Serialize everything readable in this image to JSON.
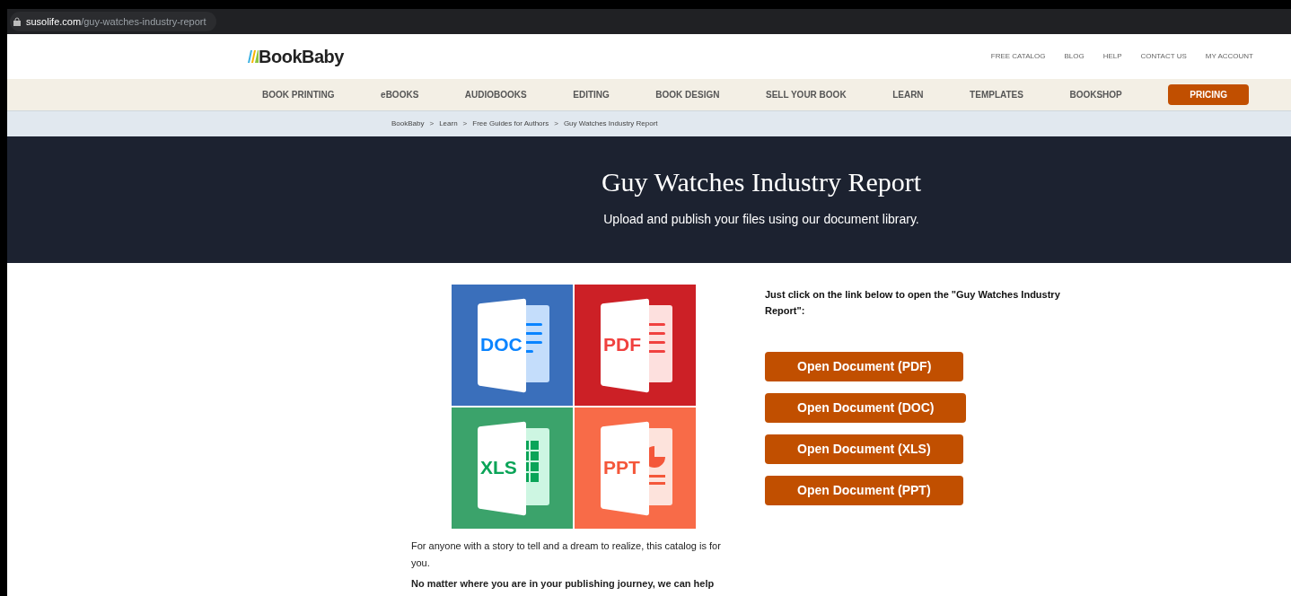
{
  "address_bar": {
    "domain": "susolife.com",
    "path": "/guy-watches-industry-report"
  },
  "logo": "BookBaby",
  "top_links": [
    "FREE CATALOG",
    "BLOG",
    "HELP",
    "CONTACT US",
    "MY ACCOUNT"
  ],
  "nav": [
    {
      "label": "BOOK PRINTING",
      "kind": "link"
    },
    {
      "label": "eBOOKS",
      "kind": "link"
    },
    {
      "label": "AUDIOBOOKS",
      "kind": "link"
    },
    {
      "label": "EDITING",
      "kind": "link"
    },
    {
      "label": "BOOK DESIGN",
      "kind": "link"
    },
    {
      "label": "SELL YOUR BOOK",
      "kind": "link"
    },
    {
      "label": "LEARN",
      "kind": "link"
    },
    {
      "label": "TEMPLATES",
      "kind": "link"
    },
    {
      "label": "BOOKSHOP",
      "kind": "link"
    },
    {
      "label": "PRICING",
      "kind": "button"
    }
  ],
  "breadcrumb": {
    "items": [
      "BookBaby",
      "Learn",
      "Free Guides for Authors",
      "Guy Watches Industry Report"
    ],
    "separator": ">"
  },
  "hero": {
    "title": "Guy Watches Industry Report",
    "subtitle": "Upload and publish your files using our document library."
  },
  "file_tiles": [
    {
      "label": "DOC",
      "kind": "doc",
      "color": "#3a6fbb"
    },
    {
      "label": "PDF",
      "kind": "pdf",
      "color": "#cc2026"
    },
    {
      "label": "XLS",
      "kind": "xls",
      "color": "#3ba36b"
    },
    {
      "label": "PPT",
      "kind": "ppt",
      "color": "#f86b48"
    }
  ],
  "intro": "Just click on the link below to open the \"Guy Watches Industry Report\":",
  "buttons": [
    "Open Document (PDF)",
    "Open Document (DOC)",
    "Open Document (XLS)",
    "Open Document (PPT)"
  ],
  "paragraphs": [
    {
      "text": "For anyone with a story to tell and a dream to realize, this catalog is for you.",
      "bold": false
    },
    {
      "text": "No matter where you are in your publishing journey, we can help",
      "bold": true
    }
  ]
}
